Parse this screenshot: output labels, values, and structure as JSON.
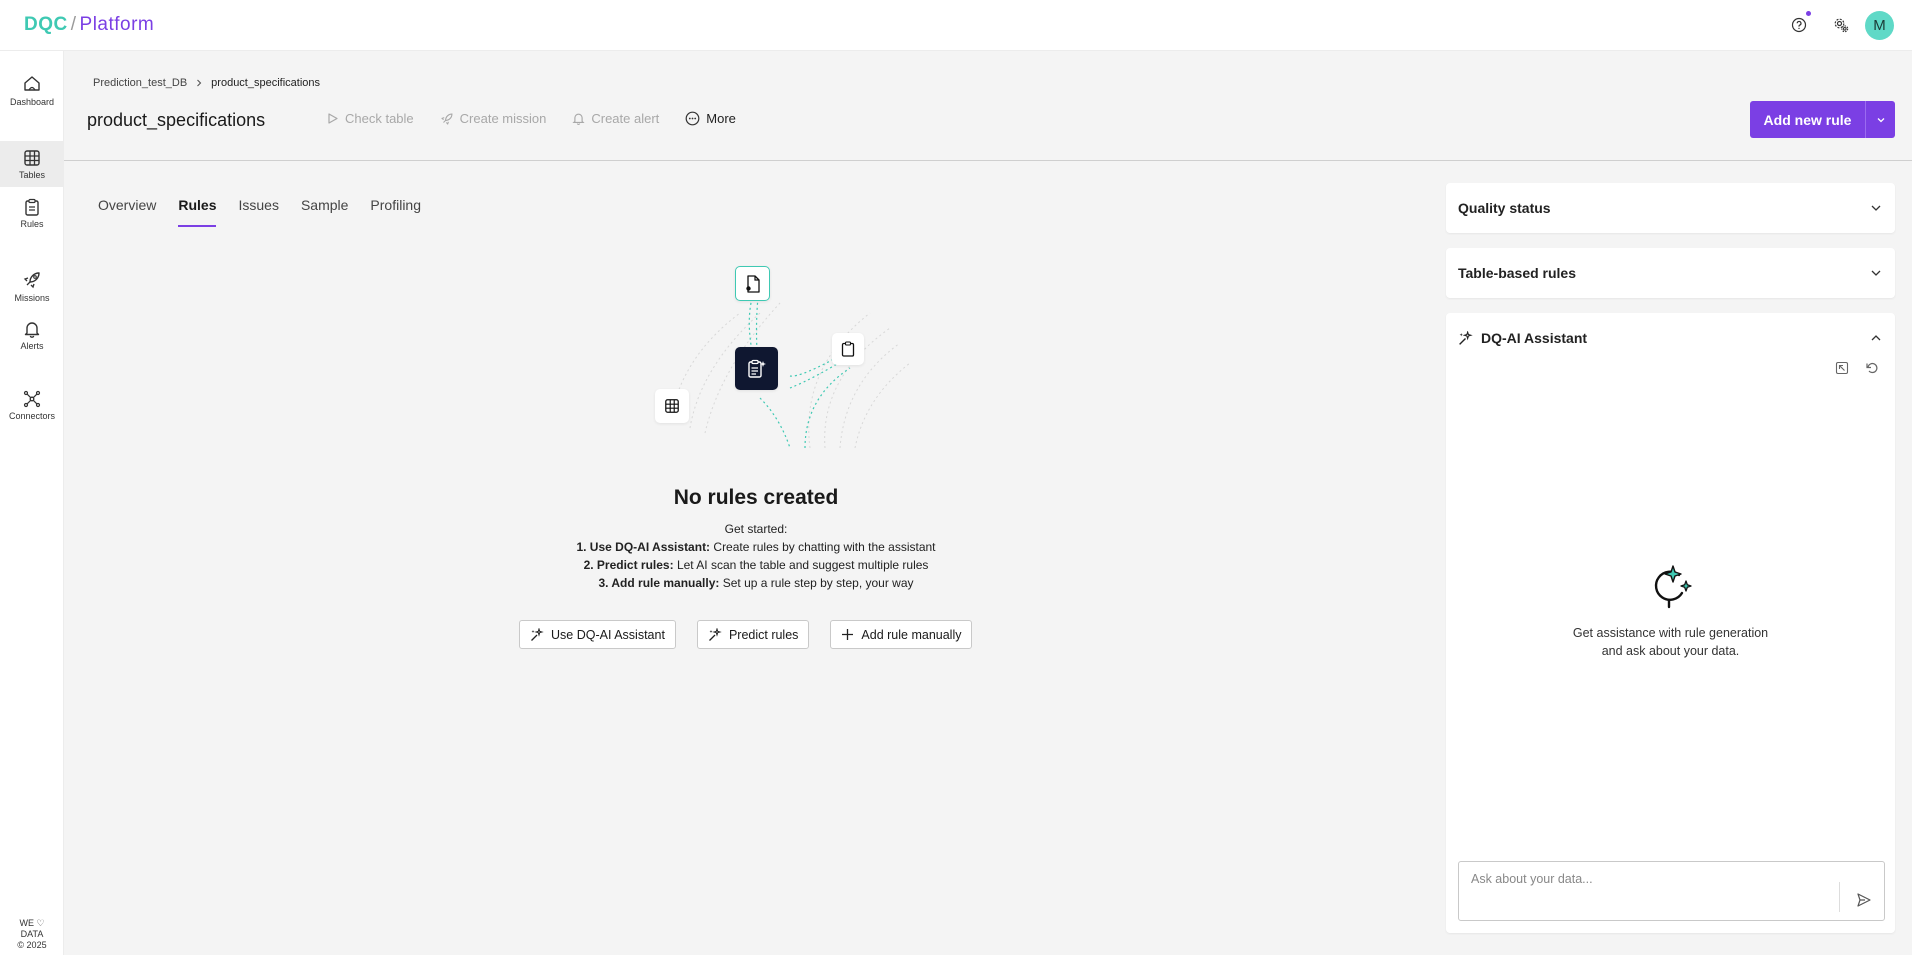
{
  "app": {
    "logo_part1": "DQC",
    "logo_sep": "/",
    "logo_part2": "Platform",
    "avatar_initial": "M",
    "brand_color": "#7b3fe4",
    "accent_color": "#3fc9b3"
  },
  "nav": {
    "items": [
      {
        "label": "Dashboard",
        "icon": "home-icon"
      },
      {
        "label": "Tables",
        "icon": "table-icon"
      },
      {
        "label": "Rules",
        "icon": "clipboard-icon"
      },
      {
        "label": "Missions",
        "icon": "rocket-icon"
      },
      {
        "label": "Alerts",
        "icon": "bell-icon"
      },
      {
        "label": "Connectors",
        "icon": "connectors-icon"
      }
    ],
    "active": "Tables",
    "footer_line1": "WE ♡",
    "footer_line2": "DATA",
    "footer_line3": "© 2025"
  },
  "breadcrumb": {
    "parent": "Prediction_test_DB",
    "current": "product_specifications"
  },
  "header": {
    "title": "product_specifications",
    "actions": {
      "check_table": "Check table",
      "create_mission": "Create mission",
      "create_alert": "Create alert",
      "more": "More"
    },
    "add_rule": "Add new rule"
  },
  "tabs": {
    "overview": "Overview",
    "rules": "Rules",
    "issues": "Issues",
    "sample": "Sample",
    "profiling": "Profiling",
    "active": "Rules"
  },
  "empty": {
    "title": "No rules created",
    "get_started": "Get started:",
    "step1_bold": "1. Use DQ-AI Assistant:",
    "step1_text": " Create rules by chatting with the assistant",
    "step2_bold": "2. Predict rules:",
    "step2_text": " Let AI scan the table and suggest multiple rules",
    "step3_bold": "3. Add rule manually:",
    "step3_text": " Set up a rule step by step, your way",
    "btn_ai": "Use DQ-AI Assistant",
    "btn_predict": "Predict rules",
    "btn_manual": "Add rule manually"
  },
  "panel": {
    "quality_status": "Quality status",
    "table_rules": "Table-based rules",
    "ai_title": "DQ-AI Assistant",
    "ai_line1": "Get assistance with rule generation",
    "ai_line2": "and ask about your data.",
    "ask_placeholder": "Ask about your data..."
  }
}
